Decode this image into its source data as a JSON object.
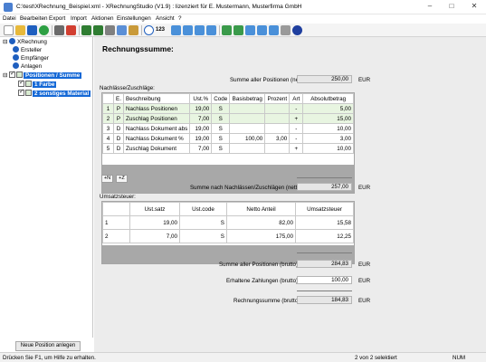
{
  "window": {
    "title": "C:\\test\\XRechnung_Beispiel.xml - XRechnungStudio (V1.9) : lizenziert für E. Mustermann, Musterfirma GmbH",
    "minimize": "–",
    "maximize": "□",
    "close": "✕"
  },
  "menu": [
    "Datei",
    "Bearbeiten",
    "Export",
    "Import",
    "Aktionen",
    "Einstellungen",
    "Ansicht",
    "?"
  ],
  "toolbar": {
    "icons": [
      "new-file-icon",
      "open-folder-icon",
      "save-icon",
      "check-icon",
      "print-icon",
      "pdf-icon",
      "undo-icon",
      "redo-icon",
      "cut-icon",
      "copy-icon",
      "paste-icon",
      "search-icon",
      "number-format-icon",
      "add-row-icon",
      "delete-row-icon",
      "move-up-icon",
      "move-down-icon",
      "attachment-icon",
      "table-icon",
      "chart-icon",
      "calculator-icon",
      "export-icon",
      "settings-icon",
      "help-icon"
    ],
    "numtext": "123"
  },
  "tree": {
    "root": "XRechnung",
    "items": [
      "Ersteller",
      "Empfänger",
      "Anlagen"
    ],
    "positions": "Positionen / Summe",
    "subitems": [
      "1 Farbe",
      "2 sonstiges Material"
    ],
    "new_position_button": "Neue Position anlegen"
  },
  "main": {
    "heading": "Rechnungssumme:",
    "sum_positions_net_label": "Summe aller Positionen (netto):",
    "sum_positions_net_value": "250,00",
    "currency": "EUR",
    "allowances_label": "Nachlässe/Zuschläge:",
    "allowance_columns": [
      "",
      "E.",
      "Beschreibung",
      "Ust.%",
      "Code",
      "Basisbetrag",
      "Prozent",
      "Art",
      "Absolutbetrag"
    ],
    "allowance_rows": [
      {
        "n": "1",
        "e": "P",
        "desc": "Nachlass Positionen",
        "ust": "19,00",
        "code": "S",
        "basis": "",
        "pct": "",
        "art": "-",
        "abs": "5,00"
      },
      {
        "n": "2",
        "e": "P",
        "desc": "Zuschlag Positionen",
        "ust": "7,00",
        "code": "S",
        "basis": "",
        "pct": "",
        "art": "+",
        "abs": "15,00"
      },
      {
        "n": "3",
        "e": "D",
        "desc": "Nachlass Dokument abs",
        "ust": "19,00",
        "code": "S",
        "basis": "",
        "pct": "",
        "art": "-",
        "abs": "10,00"
      },
      {
        "n": "4",
        "e": "D",
        "desc": "Nachlass Dokument %",
        "ust": "19,00",
        "code": "S",
        "basis": "100,00",
        "pct": "3,00",
        "art": "-",
        "abs": "3,00"
      },
      {
        "n": "5",
        "e": "D",
        "desc": "Zuschlag Dokument",
        "ust": "7,00",
        "code": "S",
        "basis": "",
        "pct": "",
        "art": "+",
        "abs": "10,00"
      }
    ],
    "add_n_button": "+N",
    "add_z_button": "+Z",
    "sum_after_allowances_label": "Summe nach Nachlässen/Zuschlägen (netto):",
    "sum_after_allowances_value": "257,00",
    "vat_label": "Umsatzsteuer:",
    "vat_columns": [
      "",
      "Ust.satz",
      "Ust.code",
      "Netto Anteil",
      "Umsatzsteuer"
    ],
    "vat_rows": [
      {
        "n": "1",
        "rate": "19,00",
        "code": "S",
        "net": "82,00",
        "vat": "15,58"
      },
      {
        "n": "2",
        "rate": "7,00",
        "code": "S",
        "net": "175,00",
        "vat": "12,25"
      }
    ],
    "sum_gross_label": "Summe aller Positionen (brutto):",
    "sum_gross_value": "284,83",
    "paid_label": "Erhaltene Zahlungen (brutto):",
    "paid_value": "100,00",
    "invoice_total_label": "Rechnungssumme (brutto):",
    "invoice_total_value": "184,83"
  },
  "status": {
    "help": "Drücken Sie F1, um Hilfe zu erhalten.",
    "selection": "2 von 2 selektiert",
    "num": "NUM"
  }
}
